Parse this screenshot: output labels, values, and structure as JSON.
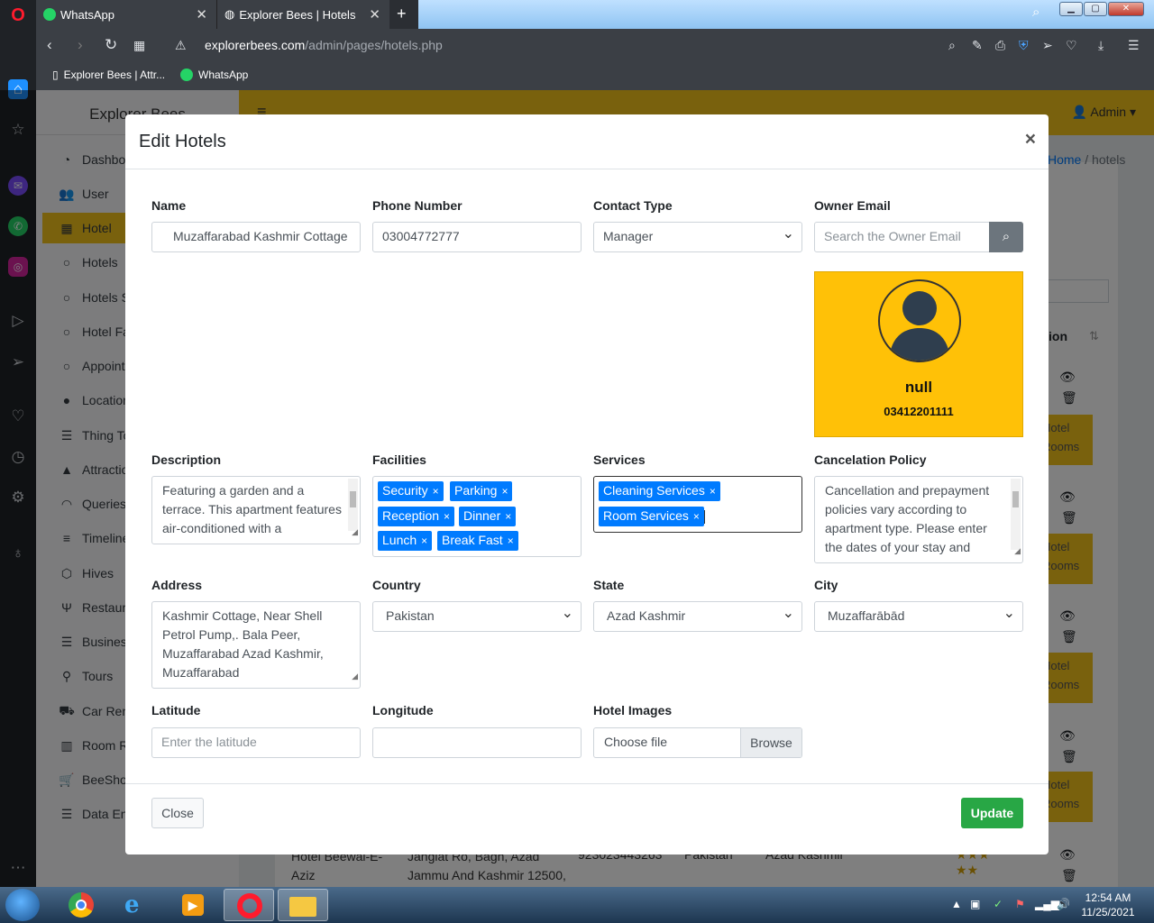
{
  "browser": {
    "tabs": [
      {
        "label": "WhatsApp"
      },
      {
        "label": "Explorer Bees | Hotels"
      }
    ],
    "url_domain": "explorerbees.com",
    "url_path": "/admin/pages/hotels.php",
    "bookmarks": [
      {
        "label": "Explorer Bees | Attr..."
      },
      {
        "label": "WhatsApp"
      }
    ]
  },
  "app": {
    "brand": "Explorer Bees",
    "user_menu": "Admin",
    "breadcrumb": {
      "home": "Home",
      "separator": "/",
      "current": "hotels"
    },
    "sidebar": [
      {
        "label": "Dashboard",
        "icon": "dashboard-icon"
      },
      {
        "label": "User",
        "icon": "users-icon"
      },
      {
        "label": "Hotel",
        "icon": "building-icon"
      },
      {
        "label": "Hotels",
        "icon": "circle-icon"
      },
      {
        "label": "Hotels S",
        "icon": "circle-icon"
      },
      {
        "label": "Hotel Fa",
        "icon": "circle-icon"
      },
      {
        "label": "Appoint",
        "icon": "circle-icon"
      },
      {
        "label": "Location",
        "icon": "map-pin-icon"
      },
      {
        "label": "Thing To",
        "icon": "list-icon"
      },
      {
        "label": "Attraction",
        "icon": "mountain-icon"
      },
      {
        "label": "Queries",
        "icon": "feed-icon"
      },
      {
        "label": "Timeline",
        "icon": "menu-icon"
      },
      {
        "label": "Hives",
        "icon": "hive-icon"
      },
      {
        "label": "Restaura",
        "icon": "utensils-icon"
      },
      {
        "label": "Business",
        "icon": "list-icon"
      },
      {
        "label": "Tours",
        "icon": "route-icon"
      },
      {
        "label": "Car Ren",
        "icon": "car-icon"
      },
      {
        "label": "Room R",
        "icon": "hotel-icon"
      },
      {
        "label": "BeeShop",
        "icon": "cart-icon"
      },
      {
        "label": "Data En",
        "icon": "list-icon"
      }
    ],
    "table_header_fragment": "ion",
    "row_button_text": "Hotel Rooms",
    "partial_row": {
      "name": "Hotel Beewal-E-Aziz",
      "address": "Jangiat Ro, Bagh, Azad Jammu And Kashmir 12500,",
      "phone": "923023443263",
      "country": "Pakistan",
      "state": "Azad Kashmir"
    }
  },
  "modal": {
    "title": "Edit Hotels",
    "close_x": "×",
    "fields": {
      "name": {
        "label": "Name",
        "value": "Muzaffarabad Kashmir Cottage"
      },
      "phone": {
        "label": "Phone Number",
        "value": "03004772777"
      },
      "contact_type": {
        "label": "Contact Type",
        "value": "Manager"
      },
      "owner_email": {
        "label": "Owner Email",
        "placeholder": "Search the Owner Email"
      },
      "description": {
        "label": "Description",
        "value": "Featuring a garden and a terrace. This apartment features air-conditioned  with a"
      },
      "facilities": {
        "label": "Facilities",
        "tags": [
          "Security",
          "Parking",
          "Reception",
          "Dinner",
          "Lunch",
          "Break Fast"
        ]
      },
      "services": {
        "label": "Services",
        "tags": [
          "Cleaning Services",
          "Room Services"
        ]
      },
      "cancelation": {
        "label": "Cancelation Policy",
        "value": "Cancellation and prepayment policies vary according to apartment type. Please enter the dates of your stay and"
      },
      "address": {
        "label": "Address",
        "value": "Kashmir Cottage, Near Shell Petrol Pump,. Bala Peer, Muzaffarabad Azad Kashmir, Muzaffarabad"
      },
      "country": {
        "label": "Country",
        "value": "Pakistan"
      },
      "state": {
        "label": "State",
        "value": "Azad Kashmir"
      },
      "city": {
        "label": "City",
        "value": "Muzaffarābād"
      },
      "latitude": {
        "label": "Latitude",
        "placeholder": "Enter the latitude"
      },
      "longitude": {
        "label": "Longitude",
        "value": ""
      },
      "images": {
        "label": "Hotel Images",
        "placeholder": "Choose file",
        "browse": "Browse"
      }
    },
    "owner_card": {
      "name": "null",
      "phone": "03412201111"
    },
    "footer": {
      "close": "Close",
      "update": "Update"
    }
  },
  "taskbar": {
    "time": "12:54 AM",
    "date": "11/25/2021"
  },
  "colors": {
    "accent": "#f2c21a",
    "tag": "#007bff",
    "update": "#28a745",
    "card": "#ffc107"
  }
}
